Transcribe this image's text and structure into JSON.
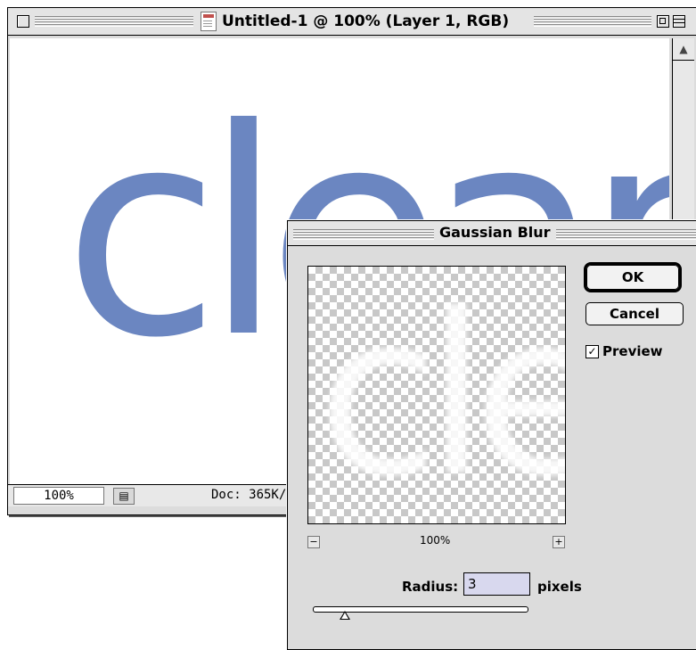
{
  "document_window": {
    "title": "Untitled-1 @ 100% (Layer 1, RGB)",
    "canvas_text": "clear",
    "status": {
      "zoom": "100%",
      "doc_size": "Doc: 365K/"
    }
  },
  "dialog": {
    "title": "Gaussian Blur",
    "ok_label": "OK",
    "cancel_label": "Cancel",
    "preview_label": "Preview",
    "preview_checked": true,
    "preview_zoom": "100%",
    "radius_label": "Radius:",
    "radius_value": "3",
    "radius_unit": "pixels",
    "slider_fraction": 0.15
  },
  "colors": {
    "text_fill": "#6b86c1",
    "radius_field": "#d8d8ee"
  },
  "icons": [
    "close-box-icon",
    "document-icon",
    "zoom-box-icon",
    "collapse-box-icon",
    "scroll-up-arrow-icon",
    "status-menu-icon",
    "zoom-minus-icon",
    "zoom-plus-icon",
    "check-icon"
  ]
}
